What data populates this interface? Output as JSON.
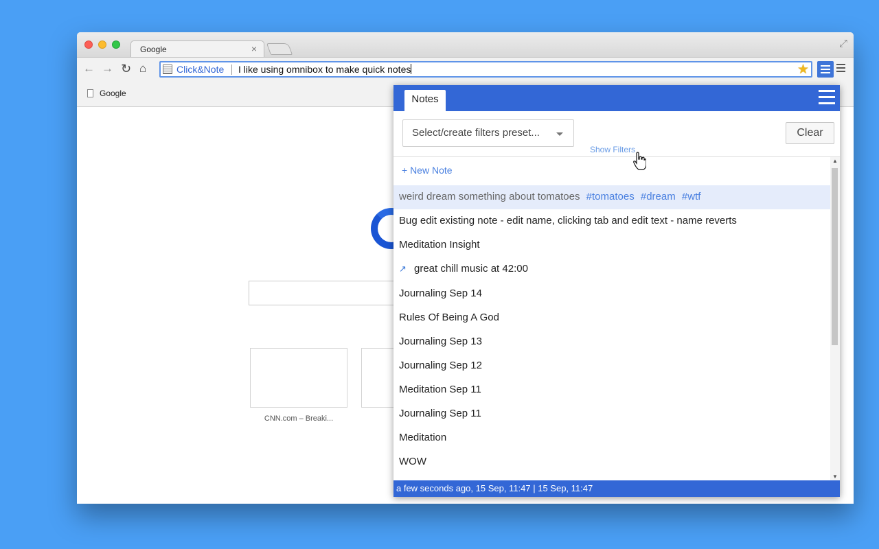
{
  "browser": {
    "tab_title": "Google",
    "tab_close": "×",
    "omnibox": {
      "keyword_label": "Click&Note",
      "text": "I like using omnibox to make quick notes"
    },
    "bookmarks": [
      {
        "label": "Google"
      }
    ]
  },
  "page": {
    "thumbnails": [
      {
        "label": "CNN.com – Breaki..."
      }
    ]
  },
  "popup": {
    "tab_label": "Notes",
    "preset_placeholder": "Select/create filters preset...",
    "clear_label": "Clear",
    "show_filters_label": "Show Filters",
    "new_note_label": "+ New Note",
    "notes": [
      {
        "title": "weird dream something about tomatoes",
        "tags": [
          "#tomatoes",
          "#dream",
          "#wtf"
        ],
        "selected": true
      },
      {
        "title": "Bug edit existing note - edit name, clicking tab and edit text - name reverts"
      },
      {
        "title": "Meditation Insight"
      },
      {
        "title": "great chill music at 42:00",
        "icon": "external-link-icon"
      },
      {
        "title": "Journaling Sep 14"
      },
      {
        "title": "Rules Of Being A God"
      },
      {
        "title": "Journaling Sep 13"
      },
      {
        "title": "Journaling Sep 12"
      },
      {
        "title": "Meditation Sep 11"
      },
      {
        "title": "Journaling Sep 11"
      },
      {
        "title": "Meditation"
      },
      {
        "title": "WOW"
      }
    ],
    "status": "a few seconds ago, 15 Sep, 11:47 | 15 Sep, 11:47"
  },
  "colors": {
    "desktop": "#4a9ff5",
    "accent": "#3367d6",
    "link": "#4a80e0",
    "selected_row": "#e5ecfb"
  }
}
